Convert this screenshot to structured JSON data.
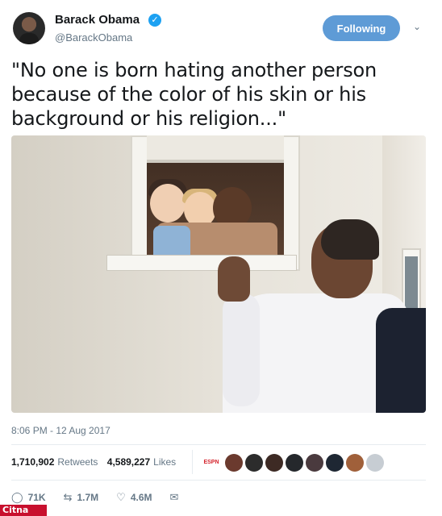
{
  "header": {
    "display_name": "Barack Obama",
    "verified_icon": "verified-badge-icon",
    "handle": "@BarackObama",
    "follow_label": "Following",
    "menu_icon": "chevron-down-icon"
  },
  "tweet": {
    "text": "\"No one is born hating another person because of the color of his skin or his background or his religion...\"",
    "timestamp": "8:06 PM - 12 Aug 2017"
  },
  "stats": {
    "retweets_count": "1,710,902",
    "retweets_label": "Retweets",
    "likes_count": "4,589,227",
    "likes_label": "Likes"
  },
  "likers": {
    "first_label": "ESPN"
  },
  "actions": {
    "reply_count": "71K",
    "retweet_count": "1.7M",
    "like_count": "4.6M"
  },
  "watermark": {
    "text": "Citna"
  },
  "colors": {
    "follow_button": "#5e9bd6",
    "verified": "#1da1f2",
    "muted_text": "#657786"
  }
}
